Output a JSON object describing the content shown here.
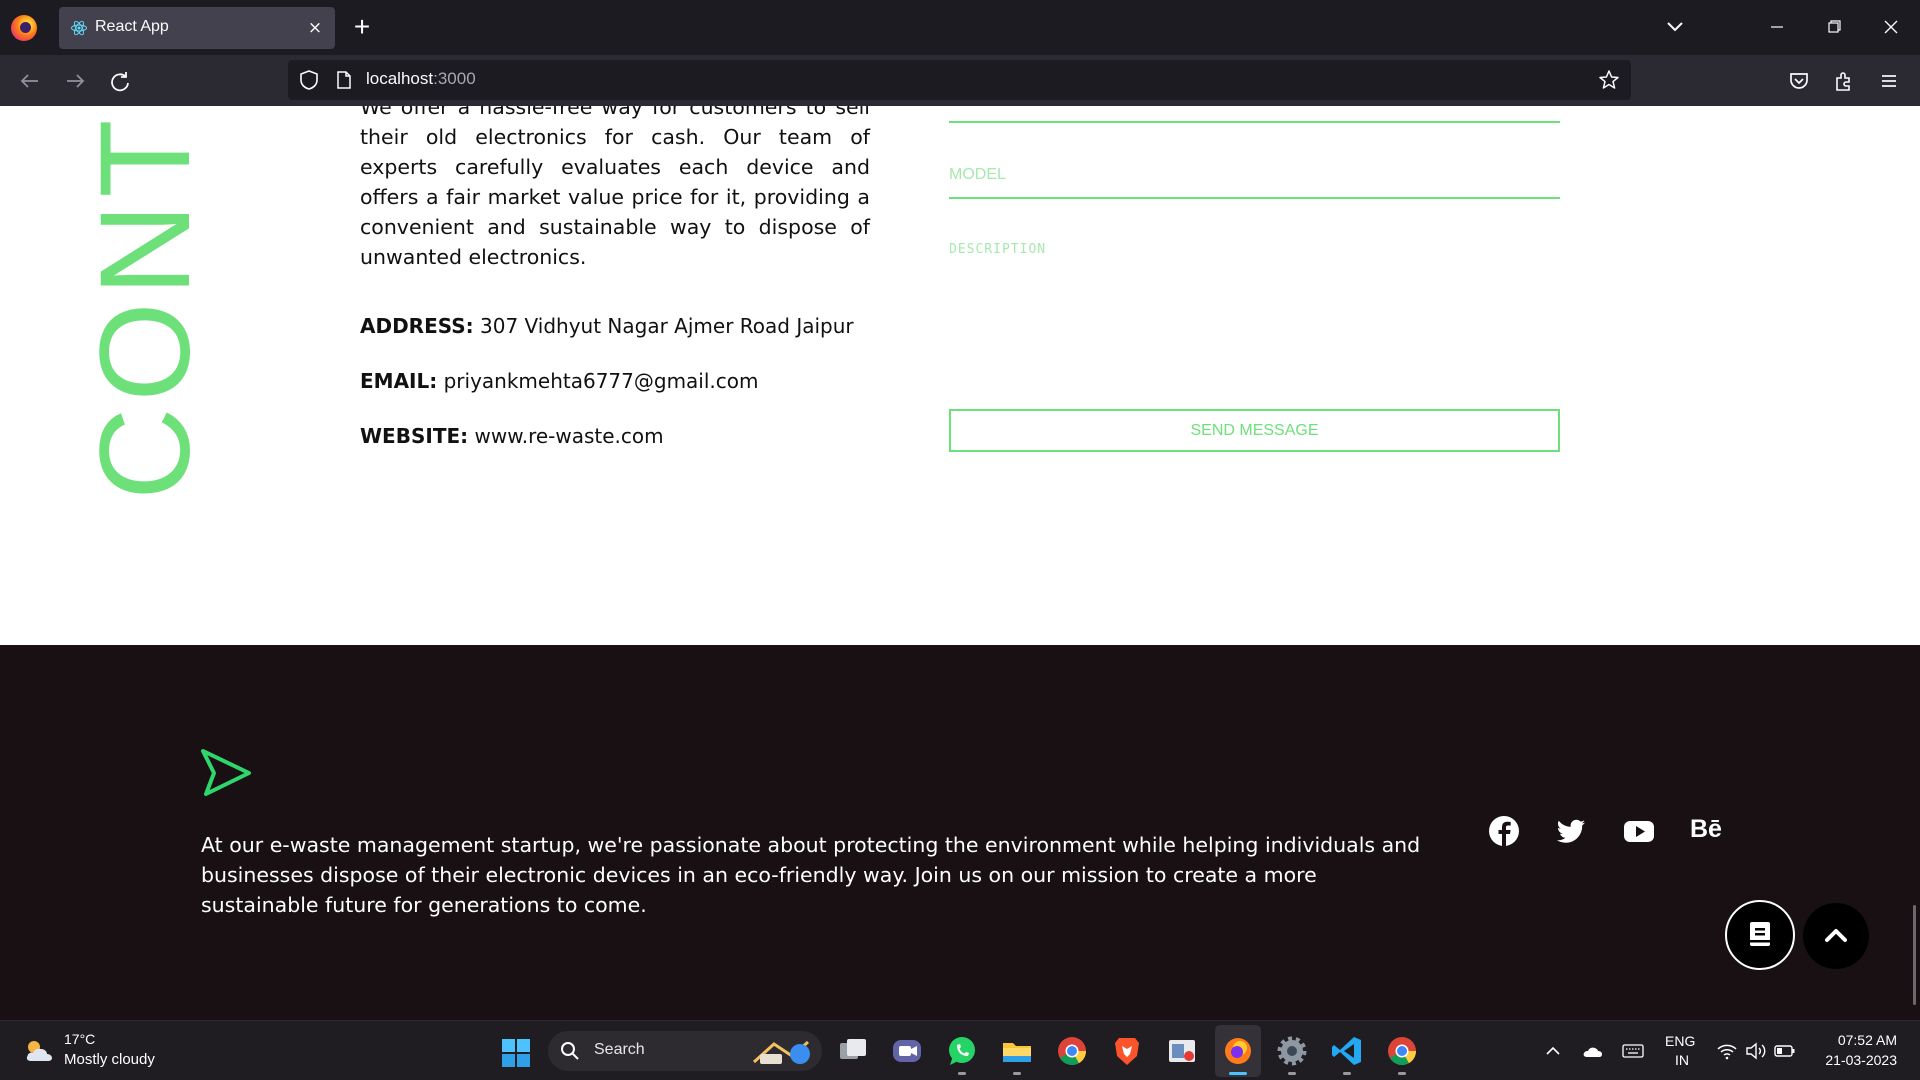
{
  "browser": {
    "tab_title": "React App",
    "tab_close": "×",
    "new_tab": "+",
    "url_host": "localhost",
    "url_port": ":3000"
  },
  "contact": {
    "vertical_title": "CONT",
    "about": "We offer a hassle-free way for customers to sell their old electronics for cash. Our team of experts carefully evaluates each device and offers a fair market value price for it, providing a convenient and sustainable way to dispose of unwanted electronics.",
    "address_label": "ADDRESS:",
    "address_value": " 307 Vidhyut Nagar Ajmer Road Jaipur",
    "email_label": "EMAIL:",
    "email_value": " priyankmehta6777@gmail.com",
    "website_label": "WEBSITE:",
    "website_value": " www.re-waste.com",
    "form": {
      "model_placeholder": "MODEL",
      "description_placeholder": "DESCRIPTION",
      "send_label": "SEND MESSAGE"
    }
  },
  "footer": {
    "text": "At our e-waste management startup, we're passionate about protecting the environment while helping individuals and businesses dispose of their electronic devices in an eco-friendly way. Join us on our mission to create a more sustainable future for generations to come.",
    "social": [
      "facebook-icon",
      "twitter-icon",
      "youtube-icon",
      "behance-icon"
    ],
    "behance_label": "Bē"
  },
  "taskbar": {
    "weather_temp": "17°C",
    "weather_desc": "Mostly cloudy",
    "search_label": "Search",
    "lang_line1": "ENG",
    "lang_line2": "IN",
    "time": "07:52 AM",
    "date": "21-03-2023"
  },
  "colors": {
    "accent_green": "#6ee07a",
    "footer_bg": "#181013",
    "taskbar_bg": "#1f1d22"
  }
}
